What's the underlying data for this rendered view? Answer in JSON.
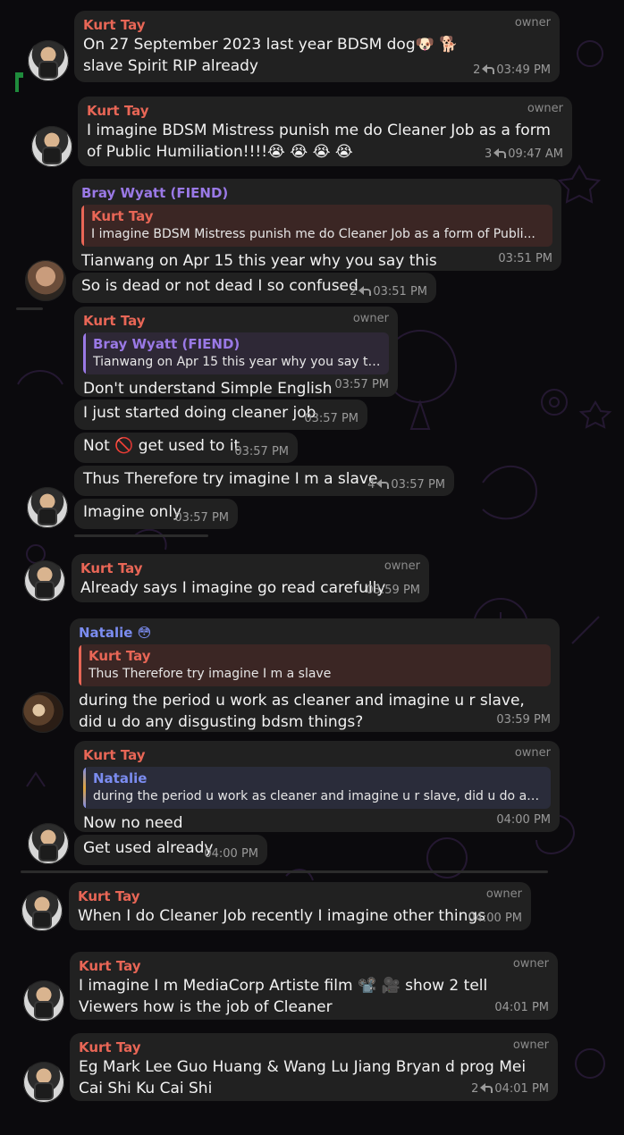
{
  "owner_label": "owner",
  "messages": [
    {
      "sender": "Kurt Tay",
      "text": "On 27 September 2023 last year BDSM dog🐶 🐕 slave Spirit RIP already",
      "replies": "2",
      "time": "03:49 PM"
    },
    {
      "sender": "Kurt Tay",
      "text": "I imagine BDSM Mistress punish me do Cleaner Job as a form of Public Humiliation!!!!😭 😭 😭 😭",
      "replies": "3",
      "time": "09:47 AM"
    },
    {
      "sender": "Bray Wyatt (FIEND)",
      "quote_name": "Kurt Tay",
      "quote_text": "I imagine BDSM Mistress punish me do Cleaner Job as a form of Publi...",
      "text": "Tianwang on Apr 15 this year why you say this",
      "time": "03:51 PM"
    },
    {
      "text": "So is dead or not dead I so confused",
      "replies": "2",
      "time": "03:51 PM"
    },
    {
      "sender": "Kurt Tay",
      "quote_name": "Bray Wyatt (FIEND)",
      "quote_text": "Tianwang on Apr 15 this year why you say this",
      "text": "Don't understand Simple English",
      "time": "03:57 PM"
    },
    {
      "text": "I just started doing cleaner job",
      "time": "03:57 PM"
    },
    {
      "text": "Not 🚫  get used to it",
      "time": "03:57 PM"
    },
    {
      "text": "Thus Therefore try imagine I m a slave",
      "replies": "4",
      "time": "03:57 PM"
    },
    {
      "text": "Imagine only",
      "time": "03:57 PM"
    },
    {
      "sender": "Kurt Tay",
      "text": "Already says I imagine go read carefully",
      "time": "03:59 PM"
    },
    {
      "sender": "Natalie 😳",
      "quote_name": "Kurt Tay",
      "quote_text": "Thus Therefore try imagine I m a slave",
      "text": "during the period u work as cleaner and imagine u r slave, did u do any disgusting bdsm things?",
      "time": "03:59 PM"
    },
    {
      "sender": "Kurt Tay",
      "quote_name": "Natalie",
      "quote_text": "during the period u work as cleaner and imagine u r slave, did u do any ...",
      "text": "Now no need",
      "time": "04:00 PM"
    },
    {
      "text": "Get used already",
      "time": "04:00 PM"
    },
    {
      "sender": "Kurt Tay",
      "text": "When I do Cleaner Job recently I imagine other things",
      "time": "04:00 PM"
    },
    {
      "sender": "Kurt Tay",
      "text": "I imagine I m MediaCorp Artiste film 📽️ 🎥  show 2 tell Viewers how is the job of Cleaner",
      "time": "04:01 PM"
    },
    {
      "sender": "Kurt Tay",
      "text": "Eg Mark Lee Guo Huang & Wang Lu Jiang Bryan d prog Mei Cai Shi Ku Cai Shi",
      "replies": "2",
      "time": "04:01 PM"
    }
  ]
}
